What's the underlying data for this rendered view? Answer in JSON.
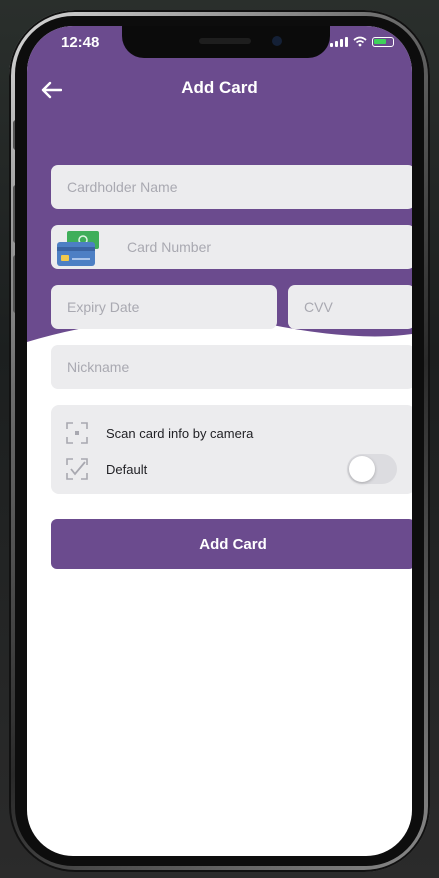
{
  "status_bar": {
    "time": "12:48"
  },
  "header": {
    "title": "Add Card",
    "back_icon": "arrow-left-icon"
  },
  "form": {
    "cardholder_name_placeholder": "Cardholder Name",
    "card_number_placeholder": "Card Number",
    "expiry_date_placeholder": "Expiry Date",
    "cvv_placeholder": "CVV",
    "nickname_placeholder": "Nickname"
  },
  "options": {
    "scan_label": "Scan card info by camera",
    "scan_icon": "scan-icon",
    "default_label": "Default",
    "default_icon": "checkmark-icon",
    "default_enabled": false
  },
  "submit": {
    "label": "Add Card"
  },
  "colors": {
    "primary": "#6b4b8e",
    "field_bg": "#ececee",
    "placeholder": "#a9a9b1"
  }
}
